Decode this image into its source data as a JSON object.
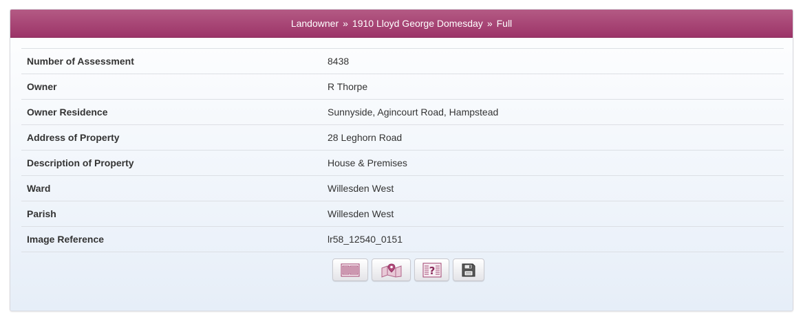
{
  "header": {
    "crumbs": [
      "Landowner",
      "1910 Lloyd George Domesday",
      "Full"
    ],
    "separator": "»"
  },
  "record": {
    "rows": [
      {
        "label": "Number of Assessment",
        "value": "8438"
      },
      {
        "label": "Owner",
        "value": "R Thorpe"
      },
      {
        "label": "Owner Residence",
        "value": "Sunnyside, Agincourt Road, Hampstead"
      },
      {
        "label": "Address of Property",
        "value": "28 Leghorn Road"
      },
      {
        "label": "Description of Property",
        "value": "House & Premises"
      },
      {
        "label": "Ward",
        "value": "Willesden West"
      },
      {
        "label": "Parish",
        "value": "Willesden West"
      },
      {
        "label": "Image Reference",
        "value": "lr58_12540_0151"
      }
    ]
  },
  "toolbar": {
    "buttons": [
      {
        "icon": "document-icon"
      },
      {
        "icon": "map-pin-icon"
      },
      {
        "icon": "help-document-icon"
      },
      {
        "icon": "save-disk-icon"
      }
    ]
  },
  "colors": {
    "header_top": "#b45a84",
    "header_bottom": "#9c3468",
    "icon_accent": "#a0406e"
  }
}
